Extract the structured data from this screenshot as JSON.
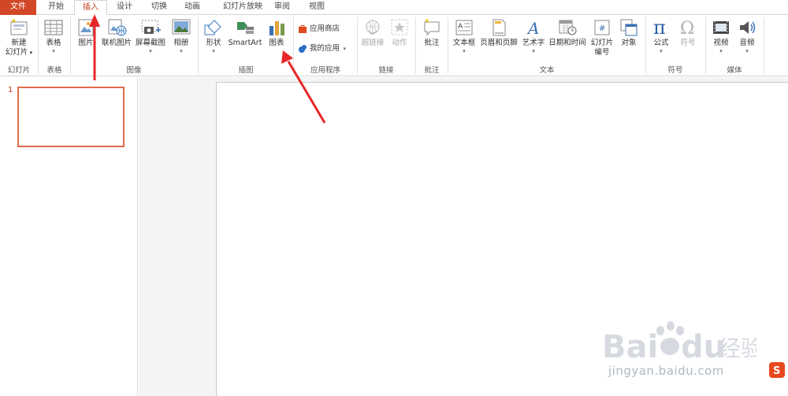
{
  "tabs": [
    {
      "label": "文件"
    },
    {
      "label": "开始"
    },
    {
      "label": "插入"
    },
    {
      "label": "设计"
    },
    {
      "label": "切换"
    },
    {
      "label": "动画"
    },
    {
      "label": "幻灯片放映"
    },
    {
      "label": "审阅"
    },
    {
      "label": "视图"
    }
  ],
  "ribbon": {
    "slides_group": {
      "new_slide_line1": "新建",
      "new_slide_line2": "幻灯片",
      "label": "幻灯片"
    },
    "tables_group": {
      "table": "表格",
      "label": "表格"
    },
    "images_group": {
      "picture": "图片",
      "online_picture": "联机图片",
      "screenshot": "屏幕截图",
      "album": "相册",
      "label": "图像"
    },
    "illustrations_group": {
      "shapes": "形状",
      "smartart": "SmartArt",
      "chart": "图表",
      "label": "插图"
    },
    "apps_group": {
      "store": "应用商店",
      "my_apps": "我的应用",
      "label": "应用程序"
    },
    "links_group": {
      "hyperlink": "超链接",
      "action": "动作",
      "label": "链接"
    },
    "comments_group": {
      "comment": "批注",
      "label": "批注"
    },
    "text_group": {
      "textbox": "文本框",
      "header_footer": "页眉和页脚",
      "wordart": "艺术字",
      "datetime": "日期和时间",
      "slide_number_line1": "幻灯片",
      "slide_number_line2": "编号",
      "object": "对象",
      "label": "文本"
    },
    "symbols_group": {
      "equation": "公式",
      "symbol": "符号",
      "label": "符号"
    },
    "media_group": {
      "video": "视频",
      "audio": "音频",
      "label": "媒体"
    }
  },
  "slides_panel": {
    "slide_number": "1"
  },
  "watermark": {
    "text": "jingyan.baidu.com"
  },
  "colors": {
    "accent": "#d24726",
    "active_tab_text": "#c43e1c",
    "thumb_border": "#e06c4b",
    "arrow": "#e8262a"
  }
}
